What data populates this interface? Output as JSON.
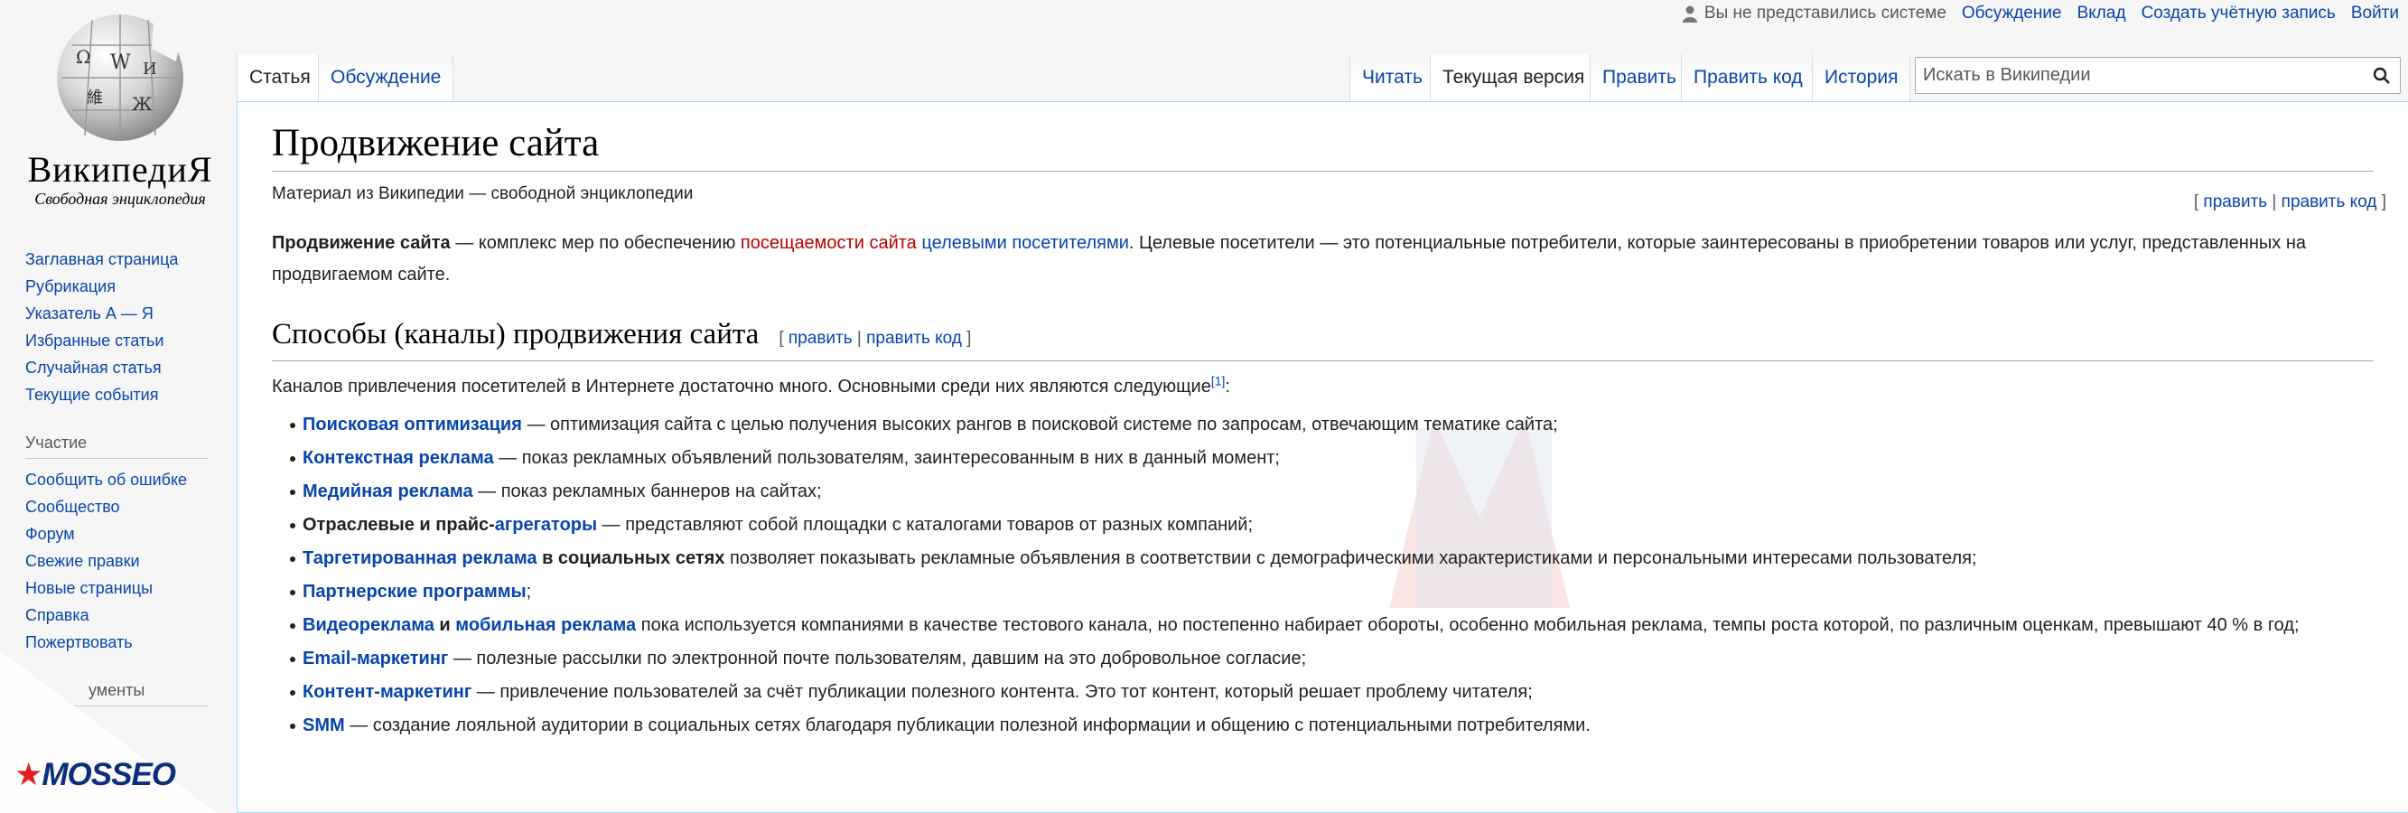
{
  "personal": {
    "anon": "Вы не представились системе",
    "links": [
      "Обсуждение",
      "Вклад",
      "Создать учётную запись",
      "Войти"
    ]
  },
  "logo": {
    "wordmark": "ВикипедиЯ",
    "tagline": "Свободная энциклопедия"
  },
  "sidebar": {
    "nav": [
      "Заглавная страница",
      "Рубрикация",
      "Указатель А — Я",
      "Избранные статьи",
      "Случайная статья",
      "Текущие события"
    ],
    "participation_head": "Участие",
    "participation": [
      "Сообщить об ошибке",
      "Сообщество",
      "Форум",
      "Свежие правки",
      "Новые страницы",
      "Справка",
      "Пожертвовать"
    ],
    "tools_head_partial": "ументы"
  },
  "tabs": {
    "left": [
      "Статья",
      "Обсуждение"
    ],
    "right": [
      "Читать",
      "Текущая версия",
      "Править",
      "Править код",
      "История"
    ]
  },
  "search": {
    "placeholder": "Искать в Википедии"
  },
  "article": {
    "title": "Продвижение сайта",
    "sitesub": "Материал из Википедии — свободной энциклопедии",
    "top_edit": {
      "edit": "править",
      "edit_code": "править код"
    },
    "intro": {
      "b": "Продвижение сайта",
      "t1": " — комплекс мер по обеспечению ",
      "red": "посещаемости сайта",
      "t2": " ",
      "link": "целевыми посетителями",
      "t3": ". Целевые посетители — это потенциальные потребители, которые заинтересованы в приобретении товаров или услуг, представленных на продвигаемом сайте."
    },
    "section": {
      "title": "Способы (каналы) продвижения сайта",
      "edit": "править",
      "edit_code": "править код",
      "lead": "Каналов привлечения посетителей в Интернете достаточно много. Основными среди них являются следующие",
      "ref": "[1]",
      "items": [
        {
          "link": "Поисковая оптимизация",
          "rest": " — оптимизация сайта с целью получения высоких рангов в поисковой системе по запросам, отвечающим тематике сайта;"
        },
        {
          "link": "Контекстная реклама",
          "rest": " — показ рекламных объявлений пользователям, заинтересованным в них в данный момент;"
        },
        {
          "link": "Медийная реклама",
          "rest": " — показ рекламных баннеров на сайтах;"
        },
        {
          "pre": "Отраслевые и прайс-",
          "link": "агрегаторы",
          "rest": " — представляют собой площадки с каталогами товаров от разных компаний;"
        },
        {
          "link": "Таргетированная реклама",
          "bold": " в социальных сетях",
          "rest": " позволяет показывать рекламные объявления в соответствии с демографическими характеристиками и персональными интересами пользователя;"
        },
        {
          "link": "Партнерские программы",
          "rest": ";"
        },
        {
          "link": "Видеореклама",
          "mid": " и ",
          "link2": "мобильная реклама",
          "rest": " пока используется компаниями в качестве тестового канала, но постепенно набирает обороты, особенно мобильная реклама, темпы роста которой, по различным оценкам, превышают 40 % в год;"
        },
        {
          "link": "Email-маркетинг",
          "rest": " — полезные рассылки по электронной почте пользователям, давшим на это добровольное согласие;"
        },
        {
          "link": "Контент-маркетинг",
          "rest": " — привлечение пользователей за счёт публикации полезного контента. Это тот контент, который решает проблему читателя;"
        },
        {
          "link": "SMM",
          "rest": " — создание лояльной аудитории в социальных сетях благодаря публикации полезной информации и общению с потенциальными потребителями."
        }
      ]
    }
  },
  "brand": {
    "name": "MOSSEO"
  }
}
